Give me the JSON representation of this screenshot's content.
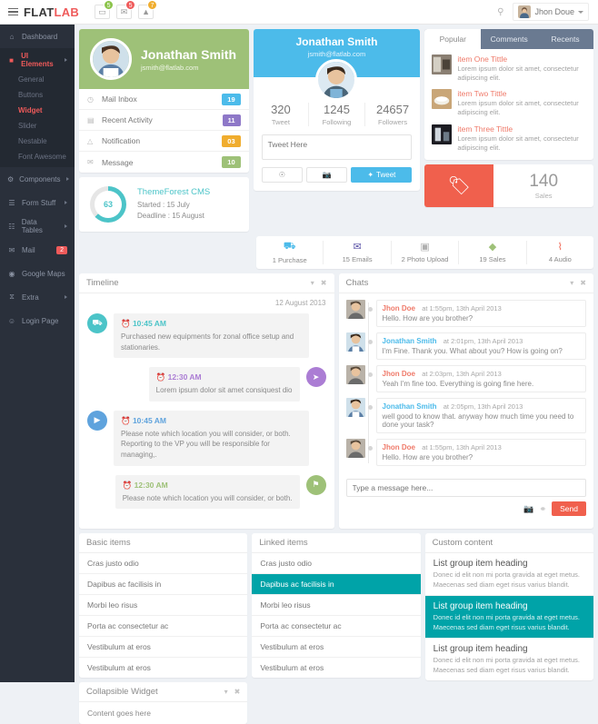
{
  "header": {
    "brand_flat": "FLAT",
    "brand_lab": "LAB",
    "menu_icon": "hamburger-icon",
    "icons": [
      {
        "name": "screen-icon",
        "glyph": "▭",
        "badge": "5",
        "color": "#8bc34a"
      },
      {
        "name": "envelope-icon",
        "glyph": "✉",
        "badge": "5",
        "color": "#ef5a5a"
      },
      {
        "name": "bell-icon",
        "glyph": "▲",
        "badge": "7",
        "color": "#f0ad2e"
      }
    ],
    "search_icon": "search-icon",
    "user_name": "Jhon Doue"
  },
  "sidebar": {
    "items": [
      {
        "label": "Dashboard",
        "icon": "⌂",
        "arrow": false,
        "active": false
      },
      {
        "label": "UI Elements",
        "icon": "■",
        "arrow": true,
        "active": true
      },
      {
        "label": "Components",
        "icon": "⚙",
        "arrow": true,
        "active": false
      },
      {
        "label": "Form Stuff",
        "icon": "☰",
        "arrow": true,
        "active": false
      },
      {
        "label": "Data Tables",
        "icon": "☷",
        "arrow": true,
        "active": false
      },
      {
        "label": "Mail",
        "icon": "✉",
        "arrow": false,
        "active": false,
        "badge": "2"
      },
      {
        "label": "Google Maps",
        "icon": "◉",
        "arrow": false,
        "active": false
      },
      {
        "label": "Extra",
        "icon": "⧖",
        "arrow": true,
        "active": false
      },
      {
        "label": "Login Page",
        "icon": "☺",
        "arrow": false,
        "active": false
      }
    ],
    "sub_items": [
      {
        "label": "General",
        "selected": false
      },
      {
        "label": "Buttons",
        "selected": false
      },
      {
        "label": "Widget",
        "selected": true
      },
      {
        "label": "Slider",
        "selected": false
      },
      {
        "label": "Nestable",
        "selected": false
      },
      {
        "label": "Font Awesome",
        "selected": false
      }
    ]
  },
  "green_profile": {
    "name": "Jonathan Smith",
    "email": "jsmith@flatlab.com",
    "stats": [
      {
        "icon": "◷",
        "label": "Mail Inbox",
        "value": "19",
        "color": "#4cbbea"
      },
      {
        "icon": "▤",
        "label": "Recent Activity",
        "value": "11",
        "color": "#8e78c8"
      },
      {
        "icon": "△",
        "label": "Notification",
        "value": "03",
        "color": "#f0ad2e"
      },
      {
        "icon": "✉",
        "label": "Message",
        "value": "10",
        "color": "#9ec178"
      }
    ]
  },
  "project": {
    "percent": "63",
    "title": "ThemeForest CMS",
    "started": "Started : 15 July",
    "deadline": "Deadline : 15 August"
  },
  "tweet_card": {
    "name": "Jonathan Smith",
    "email": "jsmith@flatlab.com",
    "stats": [
      {
        "number": "320",
        "label": "Tweet"
      },
      {
        "number": "1245",
        "label": "Following"
      },
      {
        "number": "24657",
        "label": "Followers"
      }
    ],
    "placeholder": "Tweet Here",
    "location_icon": "location-pin-icon",
    "camera_icon": "camera-icon",
    "send_label": "Tweet"
  },
  "tabs_panel": {
    "tabs": [
      {
        "label": "Popular",
        "active": true
      },
      {
        "label": "Comments",
        "active": false
      },
      {
        "label": "Recents",
        "active": false
      }
    ],
    "items": [
      {
        "title": "item One Tittle",
        "text": "Lorem ipsum dolor sit amet, consectetur adipiscing elit."
      },
      {
        "title": "item Two Tittle",
        "text": "Lorem ipsum dolor sit amet, consectetur adipiscing elit."
      },
      {
        "title": "item Three Tittle",
        "text": "Lorem ipsum dolor sit amet, consectetur adipiscing elit."
      }
    ]
  },
  "sales_widget": {
    "icon": "tag-icon",
    "number": "140",
    "label": "Sales",
    "color": "#f0604d"
  },
  "stat_strip": [
    {
      "icon": "⛟",
      "label": "1 Purchase",
      "color": "#4cbbea"
    },
    {
      "icon": "✉",
      "label": "15 Emails",
      "color": "#5d55a8"
    },
    {
      "icon": "▣",
      "label": "2 Photo Upload",
      "color": "#b0b0b0"
    },
    {
      "icon": "◆",
      "label": "19 Sales",
      "color": "#9ec178"
    },
    {
      "icon": "⌇",
      "label": "4 Audio",
      "color": "#f0604d"
    }
  ],
  "timeline": {
    "title": "Timeline",
    "date": "12 August 2013",
    "collapse_icon": "chevron-down-icon",
    "close_icon": "close-icon",
    "events": [
      {
        "side": "left",
        "icon": "⛟",
        "dot_color": "#4cc4c8",
        "time": "10:45 AM",
        "time_color": "#4cc4c8",
        "text": "Purchased new equipments for zonal office setup and stationaries."
      },
      {
        "side": "right",
        "icon": "➤",
        "dot_color": "#ab7dd4",
        "time": "12:30 AM",
        "time_color": "#ab7dd4",
        "text": "Lorem ipsum dolor sit amet consiquest dio"
      },
      {
        "side": "left",
        "icon": "▶",
        "dot_color": "#5fa3dd",
        "time": "10:45 AM",
        "time_color": "#5fa3dd",
        "text": "Please note which location you will consider, or both. Reporting to the VP you will be responsible for managing,."
      },
      {
        "side": "right",
        "icon": "⚑",
        "dot_color": "#9ec178",
        "time": "12:30 AM",
        "time_color": "#9ec178",
        "text": "Please note which location you will consider, or both."
      }
    ]
  },
  "chats": {
    "title": "Chats",
    "collapse_icon": "chevron-down-icon",
    "close_icon": "close-icon",
    "messages": [
      {
        "name": "Jhon Doe",
        "color": "red",
        "time": "at 1:55pm, 13th April 2013",
        "text": "Hello. How are you brother?"
      },
      {
        "name": "Jonathan Smith",
        "color": "blue",
        "time": "at 2:01pm, 13th April 2013",
        "text": "I'm Fine. Thank you. What about you? How is going on?"
      },
      {
        "name": "Jhon Doe",
        "color": "red",
        "time": "at 2:03pm, 13th April 2013",
        "text": "Yeah I'm fine too. Everything is going fine here."
      },
      {
        "name": "Jonathan Smith",
        "color": "blue",
        "time": "at 2:05pm, 13th April 2013",
        "text": "well good to know that. anyway how much time you need to done your task?"
      },
      {
        "name": "Jhon Doe",
        "color": "red",
        "time": "at 1:55pm, 13th April 2013",
        "text": "Hello. How are you brother?"
      }
    ],
    "placeholder": "Type a message here...",
    "camera_icon": "camera-icon",
    "attach_icon": "paperclip-icon",
    "send_label": "Send"
  },
  "basic_items": {
    "title": "Basic items",
    "items": [
      {
        "label": "Cras justo odio",
        "active": false
      },
      {
        "label": "Dapibus ac facilisis in",
        "active": false
      },
      {
        "label": "Morbi leo risus",
        "active": false
      },
      {
        "label": "Porta ac consectetur ac",
        "active": false
      },
      {
        "label": "Vestibulum at eros",
        "active": false
      },
      {
        "label": "Vestibulum at eros",
        "active": false
      }
    ]
  },
  "linked_items": {
    "title": "Linked items",
    "items": [
      {
        "label": "Cras justo odio",
        "active": false
      },
      {
        "label": "Dapibus ac facilisis in",
        "active": true
      },
      {
        "label": "Morbi leo risus",
        "active": false
      },
      {
        "label": "Porta ac consectetur ac",
        "active": false
      },
      {
        "label": "Vestibulum at eros",
        "active": false
      },
      {
        "label": "Vestibulum at eros",
        "active": false
      }
    ]
  },
  "custom_content": {
    "title": "Custom content",
    "items": [
      {
        "heading": "List group item heading",
        "text": "Donec id elit non mi porta gravida at eget metus. Maecenas sed diam eget risus varius blandit.",
        "active": false
      },
      {
        "heading": "List group item heading",
        "text": "Donec id elit non mi porta gravida at eget metus. Maecenas sed diam eget risus varius blandit.",
        "active": true
      },
      {
        "heading": "List group item heading",
        "text": "Donec id elit non mi porta gravida at eget metus. Maecenas sed diam eget risus varius blandit.",
        "active": false
      }
    ]
  },
  "collapsible_widget": {
    "title": "Collapsible Widget",
    "body": "Content goes here",
    "collapse_icon": "chevron-down-icon",
    "close_icon": "close-icon"
  }
}
